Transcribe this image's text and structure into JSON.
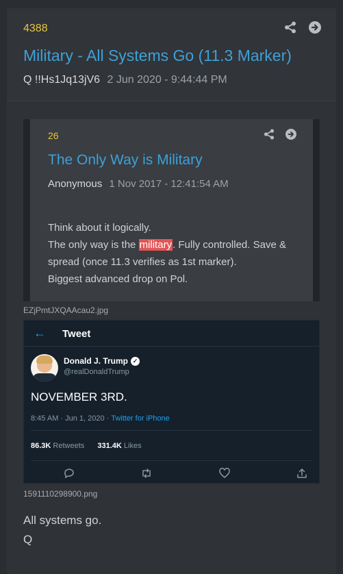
{
  "post": {
    "number": "4388",
    "title": "Military - All Systems Go (11.3 Marker)",
    "author": "Q",
    "tripcode": "!!Hs1Jq13jV6",
    "date": "2 Jun 2020 - 9:44:44 PM",
    "icons": [
      "share-icon",
      "arrow-right-circle-icon"
    ]
  },
  "quote": {
    "number": "26",
    "title": "The Only Way is Military",
    "author": "Anonymous",
    "date": "1 Nov 2017 - 12:41:54 AM",
    "line1": "Think about it logically.",
    "line2_pre": "The only way is the ",
    "line2_highlight": "military",
    "line2_post": ". Fully controlled. Save &",
    "line3": "spread (once 11.3 verifies as 1st marker).",
    "line4": "Biggest advanced drop on Pol."
  },
  "attachments": {
    "image1_filename": "EZjPmtJXQAAcau2.jpg",
    "image2_filename": "1591110298900.png"
  },
  "tweet": {
    "back_arrow": "←",
    "header": "Tweet",
    "name": "Donald J. Trump",
    "verified_mark": "✓",
    "handle": "@realDonaldTrump",
    "text": "NOVEMBER 3RD.",
    "time": "8:45 AM · Jun 1, 2020 · ",
    "source": "Twitter for iPhone",
    "retweets_count": "86.3K",
    "retweets_label": "Retweets",
    "likes_count": "331.4K",
    "likes_label": "Likes"
  },
  "footer": {
    "line1": "All systems go.",
    "line2": "Q"
  }
}
